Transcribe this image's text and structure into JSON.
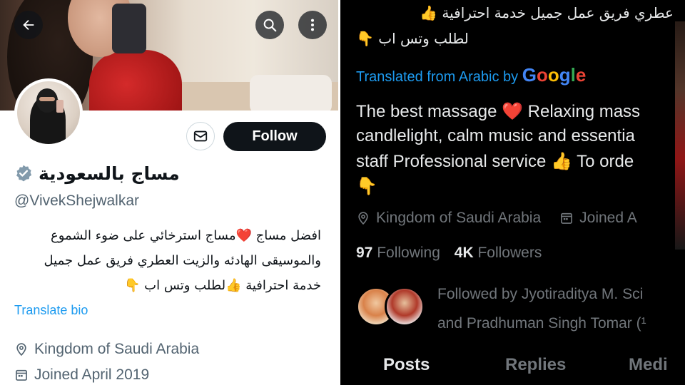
{
  "left_panel": {
    "display_name": "مساج بالسعودية",
    "handle": "@VivekShejwalkar",
    "follow_label": "Follow",
    "bio_lines": [
      "افضل مساج ❤️مساج استرخائي  على ضوء الشموع",
      "والموسيقى الهادئه والزيت العطري فريق عمل جميل",
      "خدمة احترافية 👍لطلب وتس اب 👇"
    ],
    "translate_bio_label": "Translate bio",
    "location": "Kingdom of Saudi Arabia",
    "joined": "Joined April 2019",
    "icons": {
      "back": "back-arrow-icon",
      "search": "search-icon",
      "more": "more-vertical-icon",
      "message": "envelope-icon",
      "verified": "verified-badge-icon",
      "location": "location-pin-icon",
      "calendar": "calendar-icon"
    }
  },
  "right_panel": {
    "arabic_lines": [
      "عطري فريق عمل جميل خدمة احترافية 👍",
      "لطلب وتس اب 👇"
    ],
    "translated_from": "Translated from Arabic by",
    "google_word": "Google",
    "translation_lines": [
      "The best massage ❤️ Relaxing mass",
      "candlelight, calm music and essentia",
      "staff Professional service 👍 To orde",
      "👇"
    ],
    "location": "Kingdom of Saudi Arabia",
    "joined_partial": "Joined A",
    "following_count": "97",
    "following_label": "Following",
    "followers_count": "4K",
    "followers_label": "Followers",
    "followed_by_lines": [
      "Followed by Jyotiraditya M. Sci",
      "and Pradhuman Singh Tomar (¹"
    ],
    "tabs": [
      {
        "label": "Posts",
        "active": true
      },
      {
        "label": "Replies",
        "active": false
      },
      {
        "label": "Medi",
        "active": false
      }
    ]
  },
  "colors": {
    "accent_blue": "#1d9bf0",
    "text_dark": "#0f1419",
    "text_muted_light": "#536471",
    "text_muted_dark": "#71767b",
    "text_light": "#e7e9ea"
  }
}
